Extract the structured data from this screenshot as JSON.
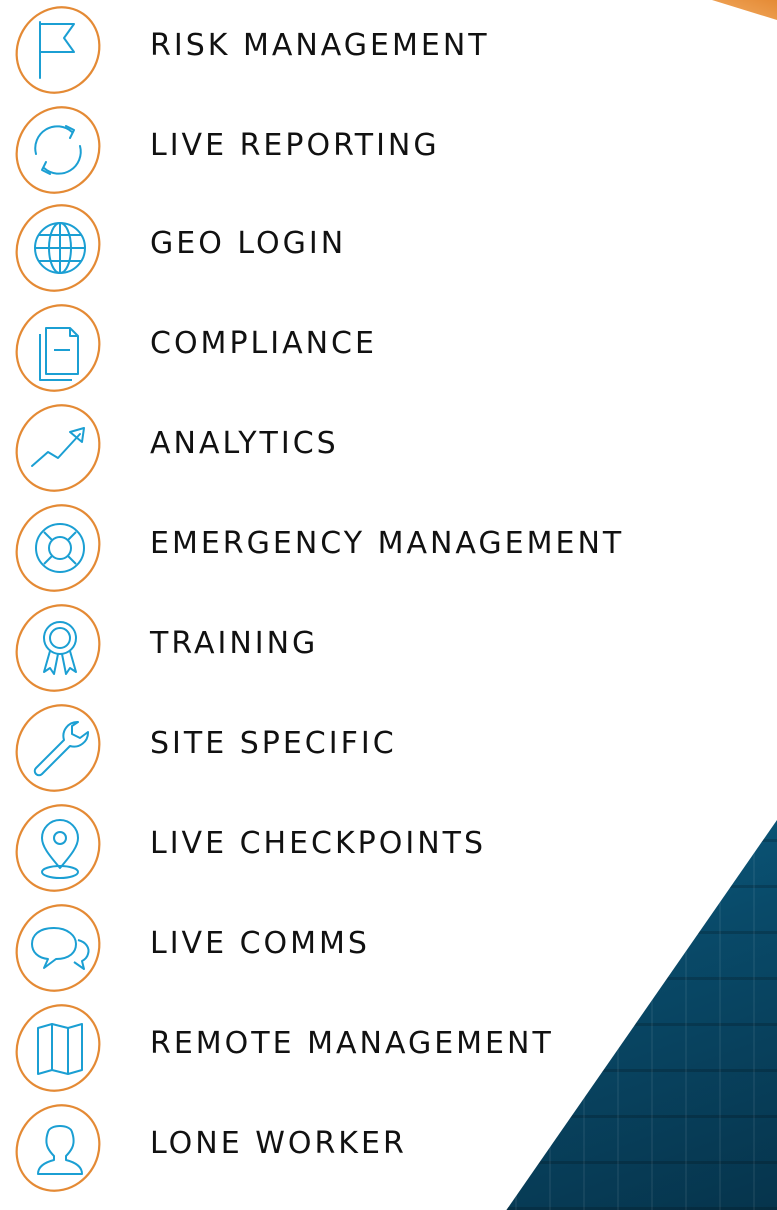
{
  "colors": {
    "accent": "#e48a35",
    "icon": "#1b9fd3",
    "text": "#111111",
    "background_panel": "#0b5f84"
  },
  "features": [
    {
      "label": "RISK MANAGEMENT",
      "icon": "flag-icon"
    },
    {
      "label": "LIVE REPORTING",
      "icon": "refresh-icon"
    },
    {
      "label": "GEO LOGIN",
      "icon": "globe-icon"
    },
    {
      "label": "COMPLIANCE",
      "icon": "document-icon"
    },
    {
      "label": "ANALYTICS",
      "icon": "trend-up-icon"
    },
    {
      "label": "EMERGENCY MANAGEMENT",
      "icon": "lifebuoy-icon"
    },
    {
      "label": "TRAINING",
      "icon": "award-ribbon-icon"
    },
    {
      "label": "SITE SPECIFIC",
      "icon": "wrench-icon"
    },
    {
      "label": "LIVE CHECKPOINTS",
      "icon": "map-pin-icon"
    },
    {
      "label": "LIVE COMMS",
      "icon": "chat-bubbles-icon"
    },
    {
      "label": "REMOTE MANAGEMENT",
      "icon": "folded-map-icon"
    },
    {
      "label": "LONE WORKER",
      "icon": "user-icon"
    }
  ]
}
